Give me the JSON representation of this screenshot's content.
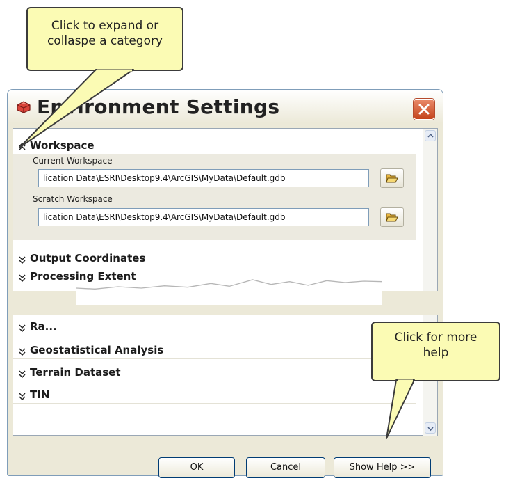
{
  "callouts": {
    "expand": "Click to expand or collaspe a category",
    "help": "Click for more help"
  },
  "dialog": {
    "title": "Environment Settings",
    "categories": {
      "workspace": "Workspace",
      "output_coordinates": "Output Coordinates",
      "processing_extent": "Processing Extent",
      "raster_partial": "Ra...",
      "geostatistical": "Geostatistical Analysis",
      "terrain": "Terrain Dataset",
      "tin": "TIN"
    },
    "workspace": {
      "current_label": "Current Workspace",
      "current_value": "lication Data\\ESRI\\Desktop9.4\\ArcGIS\\MyData\\Default.gdb",
      "scratch_label": "Scratch Workspace",
      "scratch_value": "lication Data\\ESRI\\Desktop9.4\\ArcGIS\\MyData\\Default.gdb"
    },
    "buttons": {
      "ok": "OK",
      "cancel": "Cancel",
      "help": "Show Help >>"
    }
  },
  "colors": {
    "callout_fill": "#fbfbb4",
    "close_button": "#c4431b",
    "title_text": "#222222"
  },
  "icons": {
    "app": "toolbox-icon",
    "close": "close-icon",
    "collapse": "double-chevron-up-icon",
    "expand": "double-chevron-down-icon",
    "folder": "open-folder-icon"
  }
}
